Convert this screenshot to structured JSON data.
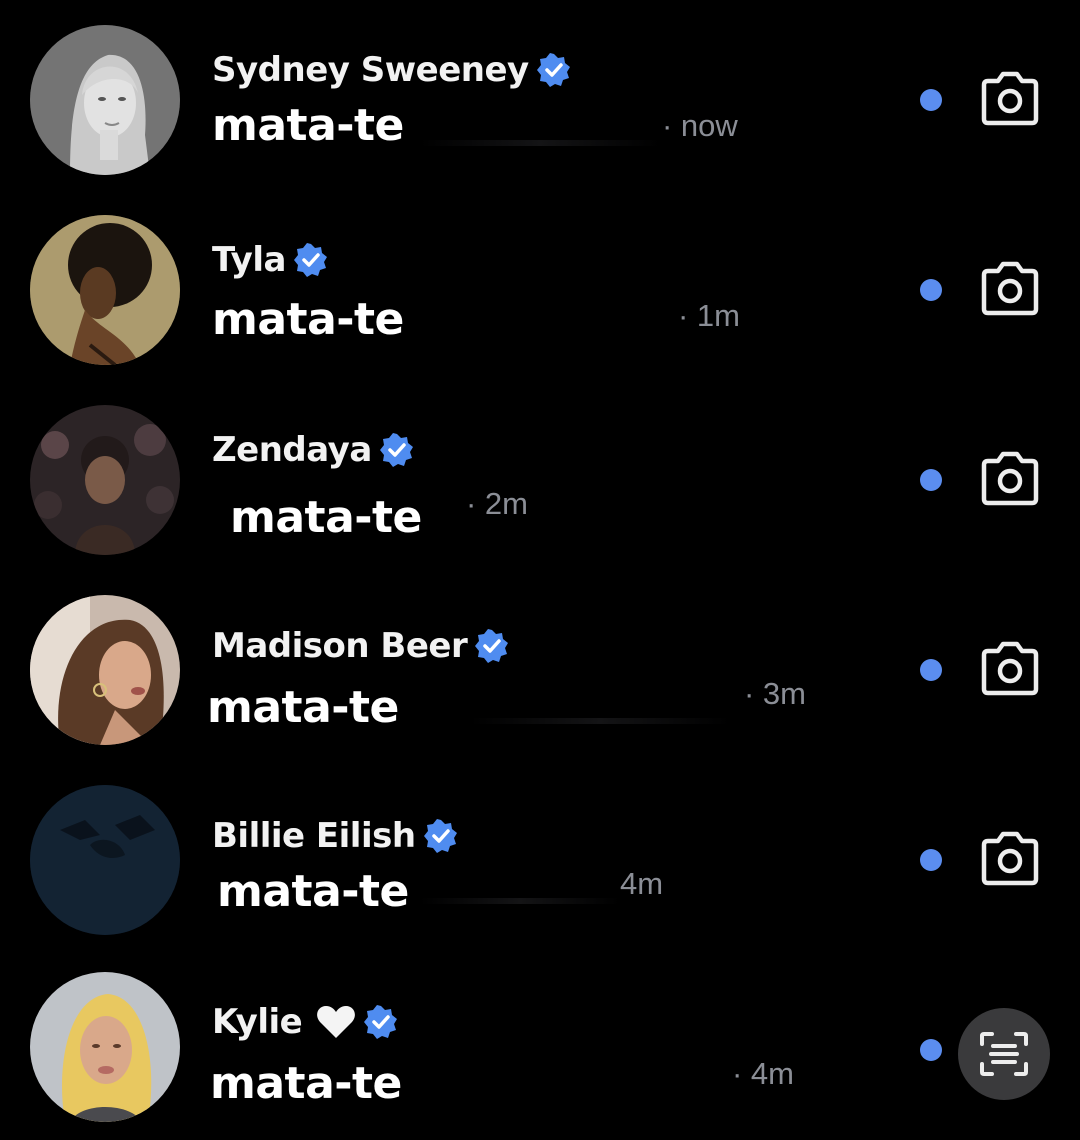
{
  "threads": [
    {
      "name": "Sydney Sweeney",
      "verified": true,
      "heart": false,
      "message": "mata-te",
      "time": "· now",
      "unread": true,
      "action_icon": "camera-icon"
    },
    {
      "name": "Tyla",
      "verified": true,
      "heart": false,
      "message": "mata-te",
      "time": "· 1m",
      "unread": true,
      "action_icon": "camera-icon"
    },
    {
      "name": "Zendaya",
      "verified": true,
      "heart": false,
      "message": "mata-te",
      "time": "· 2m",
      "unread": true,
      "action_icon": "camera-icon"
    },
    {
      "name": "Madison Beer",
      "verified": true,
      "heart": false,
      "message": "mata-te",
      "time": "· 3m",
      "unread": true,
      "action_icon": "camera-icon"
    },
    {
      "name": "Billie Eilish",
      "verified": true,
      "heart": false,
      "message": "mata-te",
      "time": "4m",
      "unread": true,
      "action_icon": "camera-icon"
    },
    {
      "name": "Kylie",
      "verified": true,
      "heart": true,
      "message": "mata-te",
      "time": "· 4m",
      "unread": true,
      "action_icon": "scan-icon"
    }
  ],
  "colors": {
    "background": "#000000",
    "name_text": "#f2f2f2",
    "message_text": "#ffffff",
    "time_text": "#8b8e96",
    "unread_dot": "#5b8def",
    "verified_badge": "#4f8cf0",
    "scan_button_bg": "#3a3a3c"
  }
}
